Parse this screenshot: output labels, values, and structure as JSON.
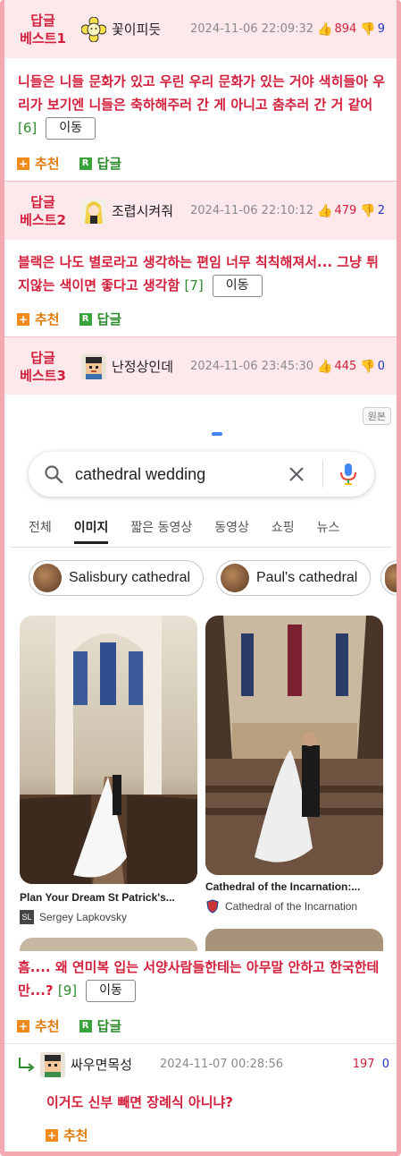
{
  "best": [
    {
      "label_line1": "답글",
      "label_line2": "베스트1",
      "nick": "꽃이피듯",
      "date": "2024-11-06 22:09:32",
      "likes": "894",
      "dislikes": "9",
      "text": "니들은 니들 문화가 있고 우린 우리 문화가 있는 거야 색히들아 우리가 보기엔 니들은 축하해주러 간 게 아니고 춤추러 간 거 같어",
      "count": "[6]"
    },
    {
      "label_line1": "답글",
      "label_line2": "베스트2",
      "nick": "조렵시켜줘",
      "date": "2024-11-06 22:10:12",
      "likes": "479",
      "dislikes": "2",
      "text": "블랙은 나도 별로라고 생각하는 편임 너무 칙칙해져서... 그냥 튀지않는 색이면 좋다고 생각함",
      "count": "[7]"
    },
    {
      "label_line1": "답글",
      "label_line2": "베스트3",
      "nick": "난정상인데",
      "date": "2024-11-06 23:45:30",
      "likes": "445",
      "dislikes": "0",
      "text": "흠.... 왜 연미복 입는 서양사람들한테는 아무말 안하고 한국한테만...?",
      "count": "[9]"
    }
  ],
  "move_label": "이동",
  "recommend_label": "추천",
  "reply_label": "답글",
  "google": {
    "original_badge": "원본",
    "query": "cathedral wedding",
    "tabs": [
      "전체",
      "이미지",
      "짧은 동영상",
      "동영상",
      "쇼핑",
      "뉴스"
    ],
    "chips": [
      "Salisbury cathedral",
      "Paul's cathedral"
    ],
    "results": [
      {
        "title": "Plan Your Dream St Patrick's...",
        "source": "Sergey Lapkovsky",
        "source_icon": "SL"
      },
      {
        "title": "Cathedral of the Incarnation:...",
        "source": "Cathedral of the Incarnation"
      }
    ]
  },
  "sub_reply": {
    "nick": "싸우면목성",
    "date": "2024-11-07 00:28:56",
    "likes": "197",
    "dislikes": "0",
    "text": "이거도 신부 빼면 장례식 아니냐?"
  },
  "colors": {
    "accent": "#d21f3c",
    "best_bg": "#fde9ec",
    "border": "#f4a9b0",
    "reply_green": "#2e8b2e",
    "recommend_orange": "#e07a10"
  }
}
